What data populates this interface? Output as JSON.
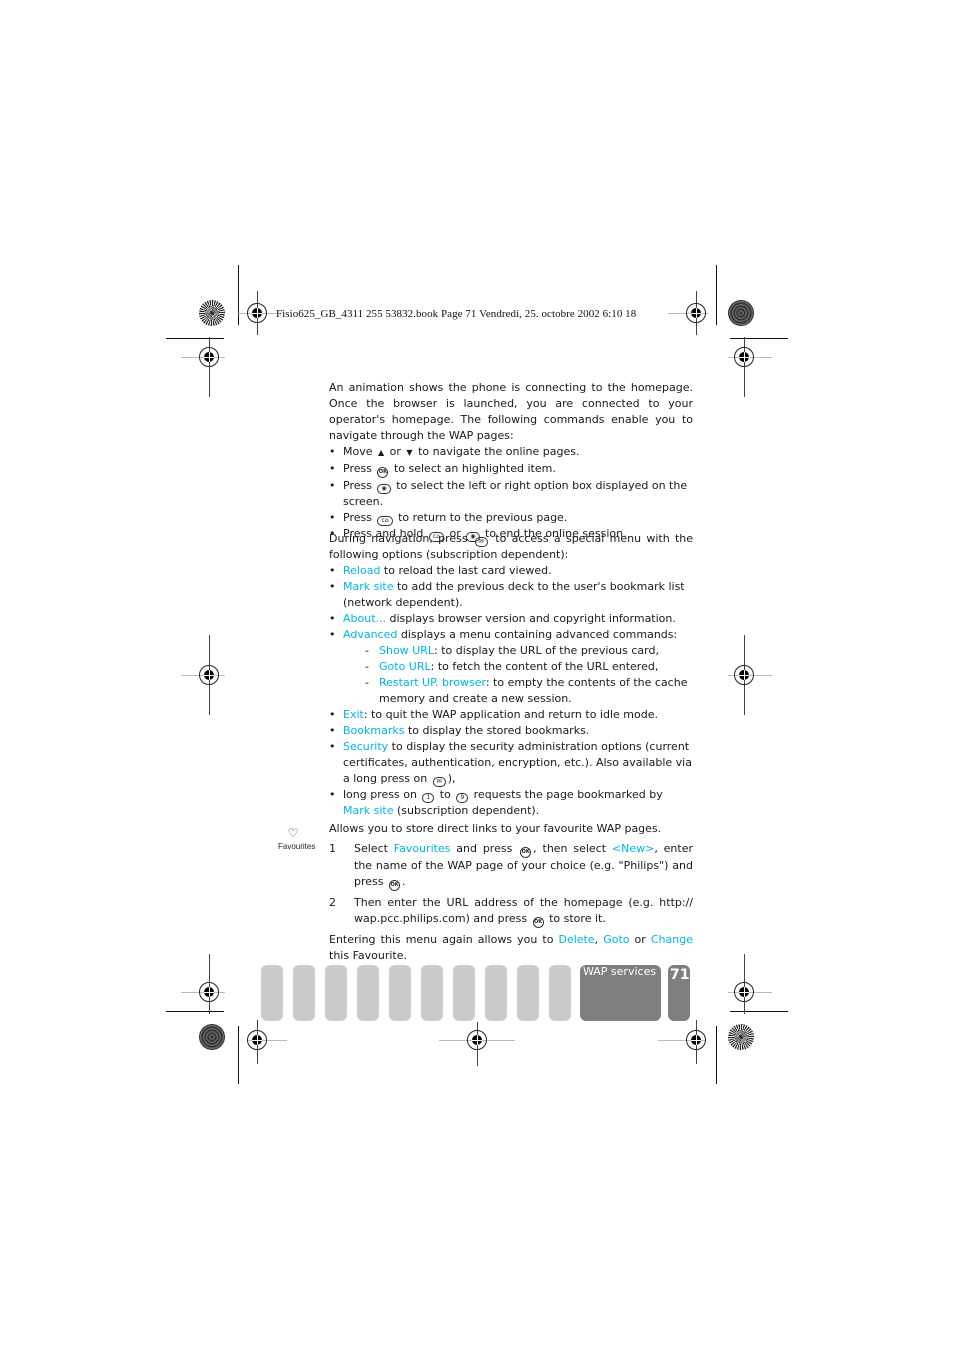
{
  "print_header": "Fisio625_GB_4311 255 53832.book  Page 71  Vendredi, 25. octobre 2002  6:10 18",
  "intro": {
    "paragraph": "An animation shows the phone is connecting to the homepage. Once the browser is launched, you are connected to your operator's homepage. The following commands enable you to navigate through the WAP pages:",
    "bullets": [
      {
        "pre": "Move",
        "mid": "or",
        "post": "to navigate the online pages.",
        "icon1": "up-arrow-icon",
        "icon2": "down-arrow-icon"
      },
      {
        "pre": "Press",
        "post": "to select an highlighted item.",
        "icon1": "ok-key-icon",
        "key1": "OK"
      },
      {
        "pre": "Press",
        "post": "to select the left or right option box displayed on the screen.",
        "icon1": "nav-key-icon",
        "key1": "◉"
      },
      {
        "pre": "Press",
        "post": "to return to the previous page.",
        "icon1": "clear-key-icon",
        "key1": "c⌂"
      },
      {
        "pre": "Press and hold",
        "mid": "or",
        "post": "to end the online session.",
        "icon1": "clear-key-icon",
        "key1": "c⌂",
        "icon2": "nav-key-icon",
        "key2": "◉"
      }
    ]
  },
  "menu": {
    "paragraph_pre": "During navigation, press",
    "paragraph_key": "✉",
    "paragraph_post": "to access a special menu with the following options (subscription dependent):",
    "items": [
      {
        "term": "Reload",
        "text": " to reload the last card viewed."
      },
      {
        "term": "Mark site",
        "text": " to add the previous deck to the user's bookmark list (network dependent)."
      },
      {
        "term": "About...",
        "text": " displays browser version and copyright information."
      },
      {
        "term": "Advanced",
        "text": " displays a menu containing advanced commands:"
      }
    ],
    "advanced": [
      {
        "term": "Show URL",
        "text": ": to display the URL of the previous card,"
      },
      {
        "term": "Goto URL",
        "text": ": to fetch the content of the URL entered,"
      },
      {
        "term": "Restart UP. browser",
        "text": ": to empty the contents of the cache memory and create a new session."
      }
    ],
    "items2": [
      {
        "term": "Exit",
        "text": ": to quit the WAP application and return to idle mode."
      },
      {
        "term": "Bookmarks",
        "text": " to display the stored bookmarks."
      },
      {
        "term": "Security",
        "text": " to display the security administration options (current certificates, authentication, encryption, etc.). Also available via a long press on",
        "key": "✉",
        "tail": "),"
      }
    ],
    "last": {
      "pre": "long press on",
      "key1": "1",
      "mid": "to",
      "key2": "9",
      "post": "requests the page bookmarked by",
      "term": "Mark site",
      "tail": "(subscription dependent)."
    }
  },
  "favourites": {
    "side_label": "Favourites",
    "intro": "Allows you to store direct links to your favourite WAP pages.",
    "steps": [
      {
        "num": "1",
        "a": "Select ",
        "t1": "Favourites",
        "b": " and press",
        "c": ", then select ",
        "t2": "<New>",
        "d": ", enter the name of the WAP page of your choice (e.g. \"Philips\") and press",
        "e": "."
      },
      {
        "num": "2",
        "a": "Then enter the URL address of the homepage (e.g. http:// wap.pcc.philips.com) and press",
        "b": "to store it."
      }
    ],
    "outro_pre": "Entering this menu again allows you to ",
    "outro_t1": "Delete",
    "outro_sep1": ", ",
    "outro_t2": "Goto",
    "outro_sep2": " or ",
    "outro_t3": "Change",
    "outro_post": " this Favourite."
  },
  "key_ok": "OK",
  "footer": {
    "section_label": "WAP services",
    "page_number": "71",
    "inactive_tab_count": 10
  },
  "colors": {
    "highlight": "#00b4e6",
    "tab_inactive": "#cbcbcb",
    "tab_active": "#7f7f7f"
  }
}
